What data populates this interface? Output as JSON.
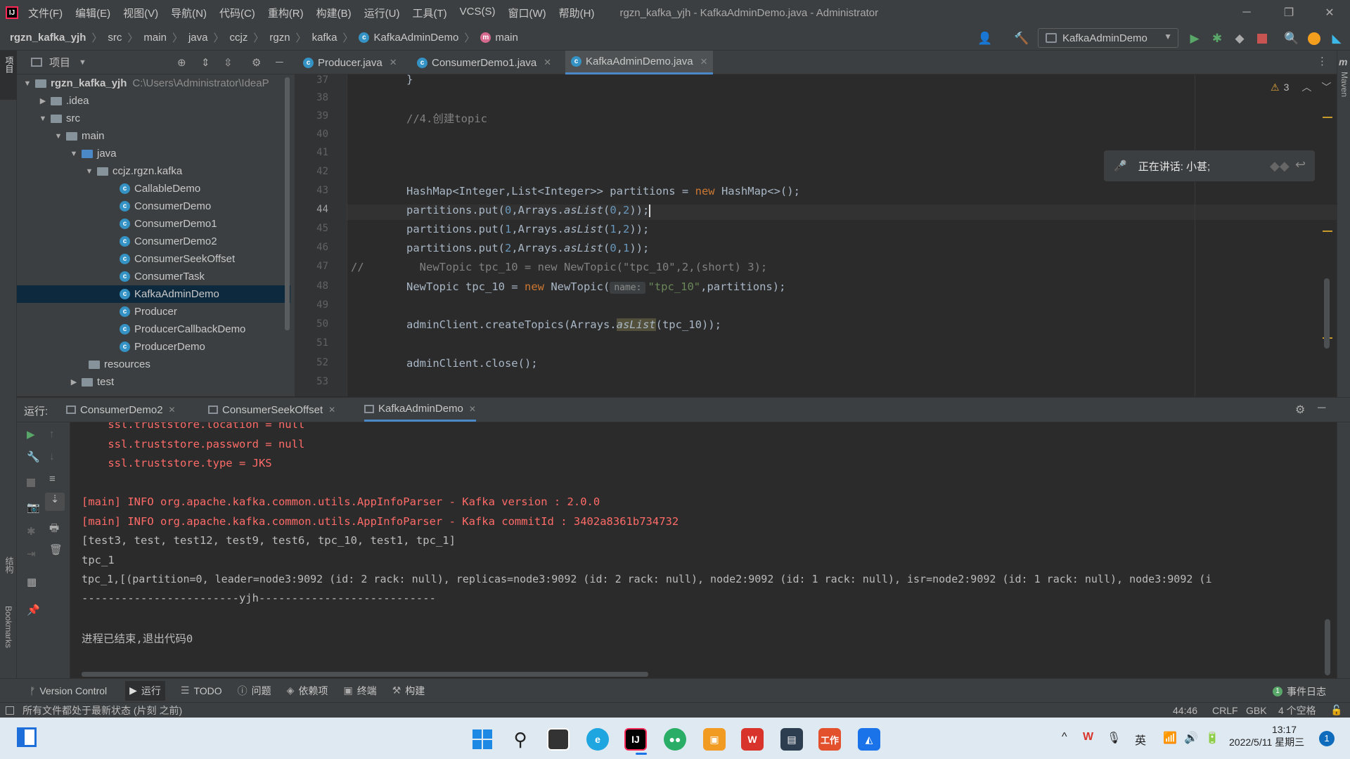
{
  "window": {
    "menu": [
      "文件(F)",
      "编辑(E)",
      "视图(V)",
      "导航(N)",
      "代码(C)",
      "重构(R)",
      "构建(B)",
      "运行(U)",
      "工具(T)",
      "VCS(S)",
      "窗口(W)",
      "帮助(H)"
    ],
    "title": "rgzn_kafka_yjh - KafkaAdminDemo.java - Administrator"
  },
  "breadcrumb": [
    "rgzn_kafka_yjh",
    "src",
    "main",
    "java",
    "ccjz",
    "rgzn",
    "kafka",
    "KafkaAdminDemo",
    "main"
  ],
  "toolbar": {
    "run_config": "KafkaAdminDemo"
  },
  "project_panel": {
    "title": "项目",
    "root_name": "rgzn_kafka_yjh",
    "root_path": "C:\\Users\\Administrator\\IdeaP",
    "nodes": [
      ".idea",
      "src",
      "main",
      "java",
      "ccjz.rgzn.kafka",
      "CallableDemo",
      "ConsumerDemo",
      "ConsumerDemo1",
      "ConsumerDemo2",
      "ConsumerSeekOffset",
      "ConsumerTask",
      "KafkaAdminDemo",
      "Producer",
      "ProducerCallbackDemo",
      "ProducerDemo",
      "resources",
      "test"
    ]
  },
  "editor": {
    "tabs": [
      "Producer.java",
      "ConsumerDemo1.java",
      "KafkaAdminDemo.java"
    ],
    "active_tab": "KafkaAdminDemo.java",
    "warnings": "3",
    "line_numbers": [
      "37",
      "38",
      "39",
      "40",
      "41",
      "42",
      "43",
      "44",
      "45",
      "46",
      "47",
      "48",
      "49",
      "50",
      "51",
      "52",
      "53"
    ],
    "code": {
      "l37": "}",
      "l39": "//4.创建topic",
      "l43a": "HashMap<Integer,List<Integer>> partitions = ",
      "l43kw": "new",
      "l43b": " HashMap<>();",
      "l44a": "partitions.put(",
      "l44n1": "0",
      "l44b": ",Arrays.",
      "l44m": "asList",
      "l44c": "(",
      "l44n2": "0",
      "l44d": ",",
      "l44n3": "2",
      "l44e": "));",
      "l45a": "partitions.put(",
      "l45n1": "1",
      "l45b": ",Arrays.",
      "l45m": "asList",
      "l45c": "(",
      "l45n2": "1",
      "l45d": ",",
      "l45n3": "2",
      "l45e": "));",
      "l46a": "partitions.put(",
      "l46n1": "2",
      "l46b": ",Arrays.",
      "l46m": "asList",
      "l46c": "(",
      "l46n2": "0",
      "l46d": ",",
      "l46n3": "1",
      "l46e": "));",
      "l47prefix": "//",
      "l47": "  NewTopic tpc_10 = new NewTopic(\"tpc_10\",2,(short) 3);",
      "l48a": "NewTopic tpc_10 = ",
      "l48kw": "new",
      "l48b": " NewTopic(",
      "l48hint": "name:",
      "l48str": "\"tpc_10\"",
      "l48c": ",partitions);",
      "l50a": "adminClient.createTopics(Arrays.",
      "l50m": "asList",
      "l50b": "(tpc_10));",
      "l52": "adminClient.close();"
    }
  },
  "speaking_popup": "正在讲话: 小甚;",
  "run_panel": {
    "label": "运行:",
    "tabs": [
      "ConsumerDemo2",
      "ConsumerSeekOffset",
      "KafkaAdminDemo"
    ],
    "output": {
      "o1": "    ssl.truststore.location = null",
      "o2": "    ssl.truststore.password = null",
      "o3": "    ssl.truststore.type = JKS",
      "o4": "[main] INFO org.apache.kafka.common.utils.AppInfoParser - Kafka version : 2.0.0",
      "o5": "[main] INFO org.apache.kafka.common.utils.AppInfoParser - Kafka commitId : 3402a8361b734732",
      "o6": "[test3, test, test12, test9, test6, tpc_10, test1, tpc_1]",
      "o7": "tpc_1",
      "o8": "tpc_1,[(partition=0, leader=node3:9092 (id: 2 rack: null), replicas=node3:9092 (id: 2 rack: null), node2:9092 (id: 1 rack: null), isr=node2:9092 (id: 1 rack: null), node3:9092 (i",
      "o9": "------------------------yjh---------------------------",
      "o10": "进程已结束,退出代码0"
    }
  },
  "tool_tabs": [
    "Version Control",
    "运行",
    "TODO",
    "问题",
    "依赖项",
    "终端",
    "构建"
  ],
  "event_log": "事件日志",
  "side_labels": {
    "left_top": "项目",
    "left_mid": "结构",
    "left_bottom": "Bookmarks",
    "right": "Maven"
  },
  "status": {
    "message": "所有文件都处于最新状态 (片刻 之前)",
    "position": "44:46",
    "line_sep": "CRLF",
    "encoding": "GBK",
    "indent": "4 个空格"
  },
  "taskbar": {
    "time": "13:17",
    "date": "2022/5/11 星期三",
    "ime": "英",
    "notifications": "1",
    "work_label": "工作"
  }
}
